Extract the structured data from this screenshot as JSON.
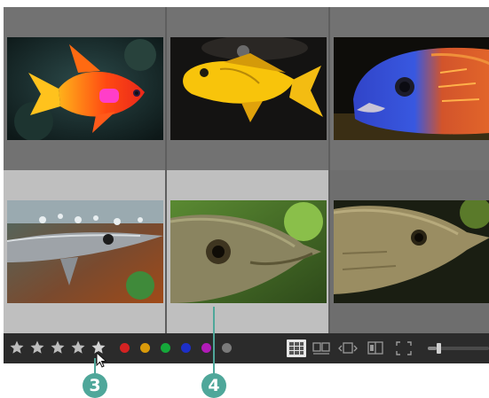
{
  "grid": {
    "cells": [
      {
        "name": "thumbnail-anthias-fish",
        "state": "normal"
      },
      {
        "name": "thumbnail-yellow-cichlid",
        "state": "normal"
      },
      {
        "name": "thumbnail-blue-orange-cichlid",
        "state": "normal"
      },
      {
        "name": "thumbnail-needlefish",
        "state": "selected"
      },
      {
        "name": "thumbnail-arowana-closeup",
        "state": "selected"
      },
      {
        "name": "thumbnail-arowana",
        "state": "unselected"
      }
    ]
  },
  "toolbar": {
    "rating_stars": 5,
    "color_labels": [
      "#d42222",
      "#d99a0a",
      "#15a83a",
      "#1d2fc8",
      "#b11bb8",
      "#7a7a7a"
    ],
    "view_modes": [
      "grid-view",
      "compare-view",
      "survey-view",
      "filmstrip-view",
      "fullscreen-view"
    ],
    "active_view": "grid-view",
    "thumbnail_zoom": 0.15
  },
  "callouts": {
    "c3": "3",
    "c4": "4"
  },
  "colors": {
    "accent": "#4fa79a",
    "toolbar_bg": "#2b2b2b",
    "selected_cell": "#bfbfbf"
  }
}
